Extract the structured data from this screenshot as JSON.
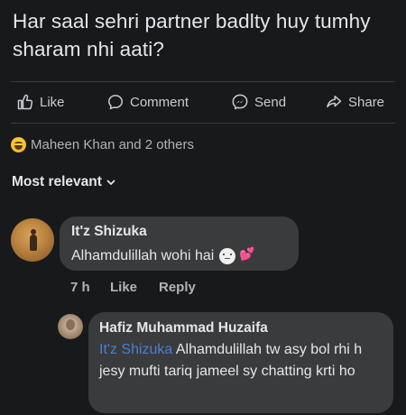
{
  "post": {
    "text": "Har saal sehri partner badlty huy tumhy sharam nhi aati?"
  },
  "actions": [
    {
      "label": "Like",
      "icon": "thumbs-up-icon"
    },
    {
      "label": "Comment",
      "icon": "comment-bubble-icon"
    },
    {
      "label": "Send",
      "icon": "messenger-icon"
    },
    {
      "label": "Share",
      "icon": "share-arrow-icon"
    }
  ],
  "reactions": {
    "icon": "haha-reaction-icon",
    "summary": "Maheen Khan and 2 others"
  },
  "sort": {
    "label": "Most relevant"
  },
  "comments": [
    {
      "author": "It'z Shizuka",
      "text": "Alhamdulillah wohi hai",
      "emoji": "🙂💕",
      "time": "7 h",
      "like_label": "Like",
      "reply_label": "Reply"
    },
    {
      "author": "Hafiz Muhammad Huzaifa",
      "mention": "It'z Shizuka",
      "text": " Alhamdulillah tw asy bol rhi h jesy mufti tariq jameel sy chatting krti ho"
    }
  ],
  "colors": {
    "background": "#18191a",
    "bubble": "#3a3b3c",
    "text": "#e4e6eb",
    "secondary_text": "#b0b3b8",
    "mention": "#4b7fd6"
  }
}
